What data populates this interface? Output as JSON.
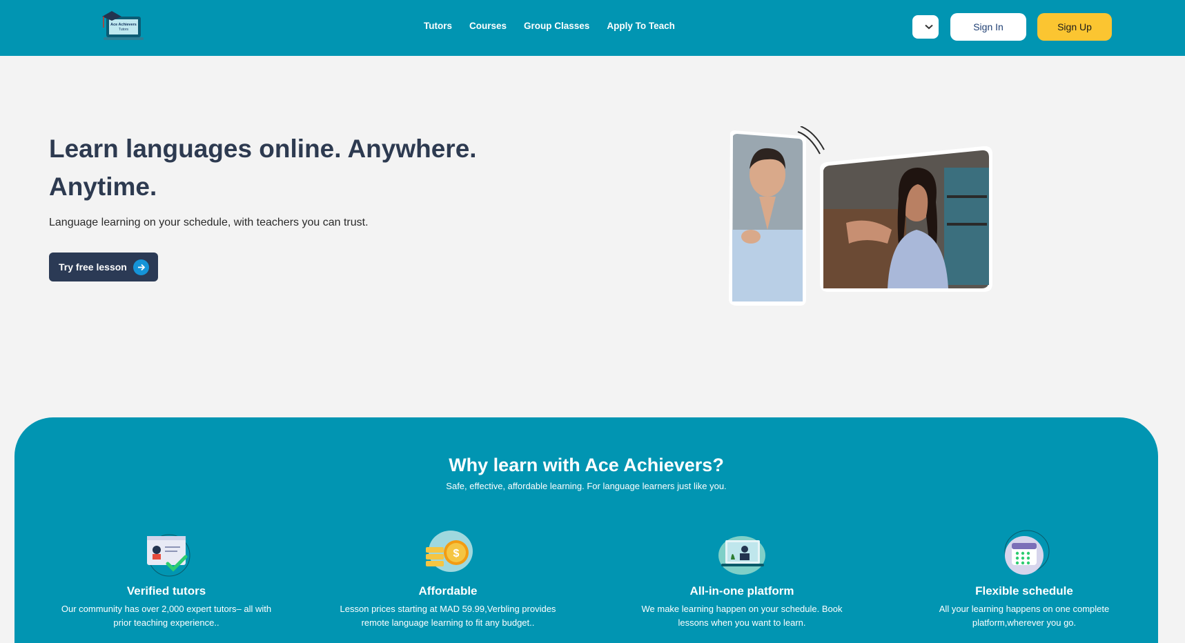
{
  "navbar": {
    "logo_text_line1": "Ace Achievers",
    "logo_text_line2": "Tutors",
    "links": [
      "Tutors",
      "Courses",
      "Group Classes",
      "Apply To Teach"
    ],
    "sign_in": "Sign In",
    "sign_up": "Sign Up"
  },
  "hero": {
    "title_line1": "Learn languages online. Anywhere.",
    "title_line2": "Anytime.",
    "subtitle": "Language learning on your schedule, with teachers you can trust.",
    "cta": "Try free lesson"
  },
  "features": {
    "title": "Why learn with Ace Achievers?",
    "subtitle": "Safe, effective, affordable learning. For language learners just like you.",
    "items": [
      {
        "title": "Verified tutors",
        "desc": "Our community has over 2,000 expert tutors– all with prior teaching experience..",
        "icon": "verified-tutor-icon"
      },
      {
        "title": "Affordable",
        "desc": "Lesson prices starting at MAD 59.99,Verbling provides remote language learning to fit any budget..",
        "icon": "coins-icon"
      },
      {
        "title": "All-in-one platform",
        "desc": "We make learning happen on your schedule. Book lessons when you want to learn.",
        "icon": "laptop-tutor-icon"
      },
      {
        "title": "Flexible schedule",
        "desc": "All your learning happens on one complete platform,wherever you go.",
        "icon": "calendar-icon"
      }
    ]
  },
  "colors": {
    "brand": "#0195b2",
    "accent": "#fbc531",
    "dark": "#2b3a55"
  }
}
